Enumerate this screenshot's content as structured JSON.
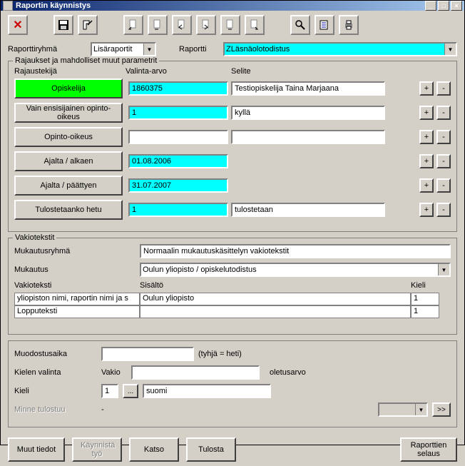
{
  "window": {
    "title": "Raportin käynnistys"
  },
  "labels": {
    "report_group": "Raporttiryhmä",
    "report": "Raportti",
    "limits_legend": "Rajaukset ja mahdolliset muut parametrit",
    "limit_col1": "Rajaustekijä",
    "limit_col2": "Valinta-arvo",
    "limit_col3": "Selite",
    "plus": "+",
    "minus": "-",
    "fixed_legend": "Vakiotekstit",
    "mukautusryhma": "Mukautusryhmä",
    "mukautus": "Mukautus",
    "vakioteksti": "Vakioteksti",
    "sisalto": "Sisältö",
    "kieli_col": "Kieli",
    "muodostusaika": "Muodostusaika",
    "empty_hint": "(tyhjä = heti)",
    "kielen_valinta": "Kielen valinta",
    "vakio": "Vakio",
    "oletusarvo": "oletusarvo",
    "kieli": "Kieli",
    "minne": "Minne tulostuu",
    "dash": "-",
    "browse": "...",
    "goto": ">>"
  },
  "values": {
    "report_group": "Lisäraportit",
    "report": "ZLäsnäolotodistus",
    "mukautusryhma": "Normaalin mukautuskäsittelyn vakiotekstit",
    "mukautus": "Oulun yliopisto / opiskelutodistus",
    "muodostusaika": "",
    "kielen_valinta": "",
    "kieli_num": "1",
    "kieli_name": "suomi",
    "minne": ""
  },
  "params": [
    {
      "label": "Opiskelija",
      "green": true,
      "value": "1860375",
      "desc": "Testiopiskelija Taina Marjaana",
      "cyan": true,
      "desc_shown": true
    },
    {
      "label": "Vain ensisijainen opinto-oikeus",
      "value": "1",
      "desc": "kyllä",
      "cyan": true,
      "desc_shown": true
    },
    {
      "label": "Opinto-oikeus",
      "value": "",
      "desc": "",
      "cyan": false,
      "desc_shown": true
    },
    {
      "label": "Ajalta / alkaen",
      "value": "01.08.2006",
      "desc": "",
      "cyan": true,
      "desc_shown": false
    },
    {
      "label": "Ajalta / päättyen",
      "value": "31.07.2007",
      "desc": "",
      "cyan": true,
      "desc_shown": false
    },
    {
      "label": "Tulostetaanko hetu",
      "value": "1",
      "desc": "tulostetaan",
      "cyan": true,
      "desc_shown": true
    }
  ],
  "texts": [
    {
      "name": "yliopiston nimi, raportin nimi ja s",
      "content": "Oulun yliopisto",
      "lang": "1"
    },
    {
      "name": "Lopputeksti",
      "content": "",
      "lang": "1"
    }
  ],
  "buttons": {
    "muut": "Muut tiedot",
    "kaynnista": "Käynnistä työ",
    "katso": "Katso",
    "tulosta": "Tulosta",
    "selaus": "Raporttien selaus"
  }
}
